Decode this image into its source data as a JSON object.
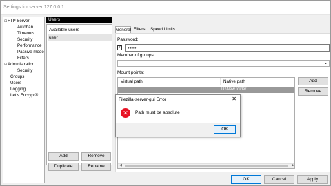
{
  "window": {
    "title": "Settings for server 127.0.0.1"
  },
  "tree": [
    {
      "label": "FTP Server",
      "expander": "⊟",
      "indent": 0
    },
    {
      "label": "Autoban",
      "expander": "",
      "indent": 1
    },
    {
      "label": "Timeouts",
      "expander": "",
      "indent": 1
    },
    {
      "label": "Security",
      "expander": "",
      "indent": 1
    },
    {
      "label": "Performance",
      "expander": "",
      "indent": 1
    },
    {
      "label": "Passive mode",
      "expander": "",
      "indent": 1
    },
    {
      "label": "Filters",
      "expander": "",
      "indent": 1
    },
    {
      "label": "Administration",
      "expander": "⊟",
      "indent": 0
    },
    {
      "label": "Security",
      "expander": "",
      "indent": 1
    },
    {
      "label": "Groups",
      "expander": "",
      "indent": 0
    },
    {
      "label": "Users",
      "expander": "",
      "indent": 0
    },
    {
      "label": "Logging",
      "expander": "",
      "indent": 0
    },
    {
      "label": "Let's Encrypt®",
      "expander": "",
      "indent": 0
    }
  ],
  "users_panel": {
    "header": "Users",
    "items": [
      "Available users",
      "user"
    ],
    "add_label": "Add",
    "remove_label": "Remove",
    "duplicate_label": "Duplicate",
    "rename_label": "Rename"
  },
  "tabs": [
    "General",
    "Filters",
    "Speed Limits"
  ],
  "general": {
    "password_label": "Password:",
    "password_checked": "✓",
    "password_value": "••••",
    "member_label": "Member of groups:",
    "member_value": "",
    "mount_label": "Mount points:",
    "col_virtual": "Virtual path",
    "col_native": "Native path",
    "rows": [
      {
        "virtual": "",
        "native": ""
      },
      {
        "virtual": "",
        "native": "D:\\New folder"
      }
    ],
    "add_label": "Add",
    "remove_label": "Remove"
  },
  "dialog": {
    "title": "Filezilla-server-gui Error",
    "close": "✕",
    "message": "Path must be absolute",
    "ok_label": "OK"
  },
  "footer": {
    "ok_label": "OK",
    "cancel_label": "Cancel",
    "apply_label": "Apply"
  },
  "colors": {
    "error": "#e81123",
    "selection": "#cce8ff",
    "accent": "#0078d7"
  }
}
